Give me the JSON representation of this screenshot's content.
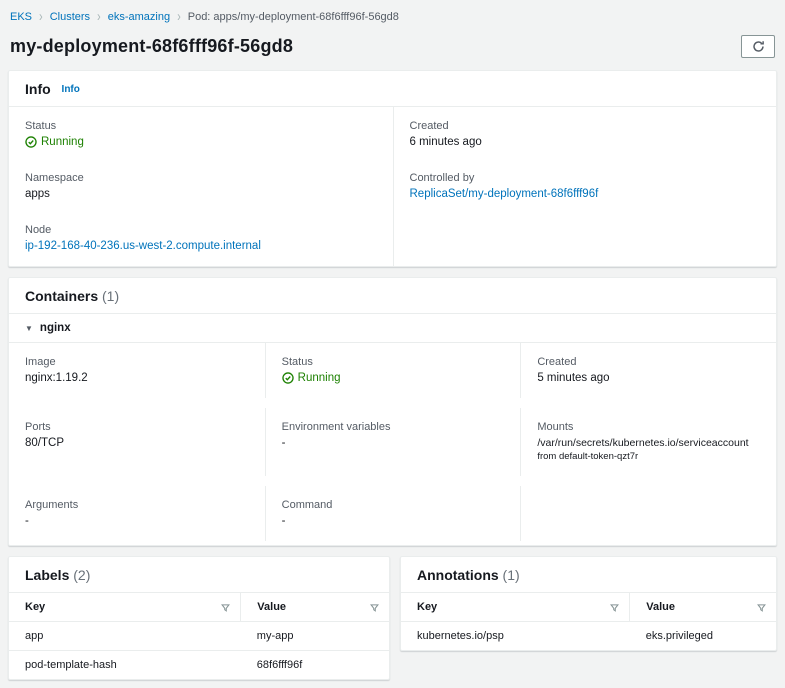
{
  "breadcrumb": {
    "items": [
      {
        "label": "EKS"
      },
      {
        "label": "Clusters"
      },
      {
        "label": "eks-amazing"
      }
    ],
    "current": "Pod: apps/my-deployment-68f6fff96f-56gd8"
  },
  "header": {
    "title": "my-deployment-68f6fff96f-56gd8",
    "refresh_icon": "refresh-icon"
  },
  "info_card": {
    "title": "Info",
    "info_link": "Info",
    "status": {
      "label": "Status",
      "value": "Running"
    },
    "created": {
      "label": "Created",
      "value": "6 minutes ago"
    },
    "namespace": {
      "label": "Namespace",
      "value": "apps"
    },
    "controlled_by": {
      "label": "Controlled by",
      "value": "ReplicaSet/my-deployment-68f6fff96f"
    },
    "node": {
      "label": "Node",
      "value": "ip-192-168-40-236.us-west-2.compute.internal"
    }
  },
  "containers_card": {
    "title": "Containers",
    "count": "(1)",
    "container_name": "nginx",
    "image": {
      "label": "Image",
      "value": "nginx:1.19.2"
    },
    "status": {
      "label": "Status",
      "value": "Running"
    },
    "created": {
      "label": "Created",
      "value": "5 minutes ago"
    },
    "ports": {
      "label": "Ports",
      "value": "80/TCP"
    },
    "env": {
      "label": "Environment variables",
      "value": "-"
    },
    "mounts": {
      "label": "Mounts",
      "value": "/var/run/secrets/kubernetes.io/serviceaccount",
      "sub": "from default-token-qzt7r"
    },
    "arguments": {
      "label": "Arguments",
      "value": "-"
    },
    "command": {
      "label": "Command",
      "value": "-"
    }
  },
  "labels_card": {
    "title": "Labels",
    "count": "(2)",
    "columns": {
      "key": "Key",
      "value": "Value"
    },
    "rows": [
      {
        "key": "app",
        "value": "my-app"
      },
      {
        "key": "pod-template-hash",
        "value": "68f6fff96f"
      }
    ]
  },
  "annotations_card": {
    "title": "Annotations",
    "count": "(1)",
    "columns": {
      "key": "Key",
      "value": "Value"
    },
    "rows": [
      {
        "key": "kubernetes.io/psp",
        "value": "eks.privileged"
      }
    ]
  },
  "colors": {
    "link": "#0073bb",
    "success": "#1d8102",
    "label_gray": "#545b64",
    "text": "#16191f",
    "page_bg": "#f2f3f3",
    "card_border": "#eaeded"
  }
}
